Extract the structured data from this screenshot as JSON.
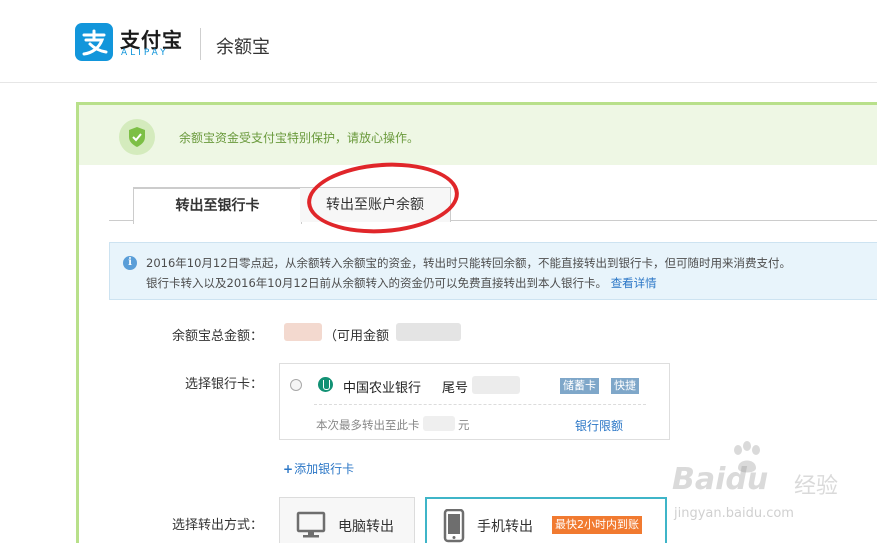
{
  "header": {
    "brand_name": "支付宝",
    "brand_sub": "ALIPAY",
    "page_title": "余额宝"
  },
  "notice": {
    "text": "余额宝资金受支付宝特别保护，请放心操作。"
  },
  "tabs": [
    {
      "label": "转出至银行卡",
      "active": true
    },
    {
      "label": "转出至账户余额",
      "active": false
    }
  ],
  "info": {
    "line1": "2016年10月12日零点起，从余额转入余额宝的资金，转出时只能转回余额，不能直接转出到银行卡，但可随时用来消费支付。",
    "line2": "银行卡转入以及2016年10月12日前从余额转入的资金仍可以免费直接转出到本人银行卡。",
    "link": "查看详情"
  },
  "form": {
    "total_label": "余额宝总金额：",
    "available_prefix": "（可用金额",
    "bank_label": "选择银行卡：",
    "method_label": "选择转出方式："
  },
  "bank_card": {
    "name": "中国农业银行",
    "tail_label": "尾号",
    "tags": [
      "储蓄卡",
      "快捷"
    ],
    "limit_text": "本次最多转出至此卡",
    "limit_unit": "元",
    "limit_link": "银行限额"
  },
  "add_card": {
    "plus": "+",
    "label": "添加银行卡"
  },
  "methods": {
    "pc_label": "电脑转出",
    "mobile_label": "手机转出",
    "mobile_badge": "最快2小时内到账"
  },
  "watermark": {
    "logo": "Baidu",
    "cn": "经验",
    "url": "jingyan.baidu.com"
  },
  "colors": {
    "brand_blue": "#1296db",
    "panel_border": "#b8e08a",
    "highlight_ring": "#e0262a",
    "link_blue": "#2a76c6",
    "badge_orange": "#f17a30",
    "selected_teal": "#3fb5c8"
  }
}
